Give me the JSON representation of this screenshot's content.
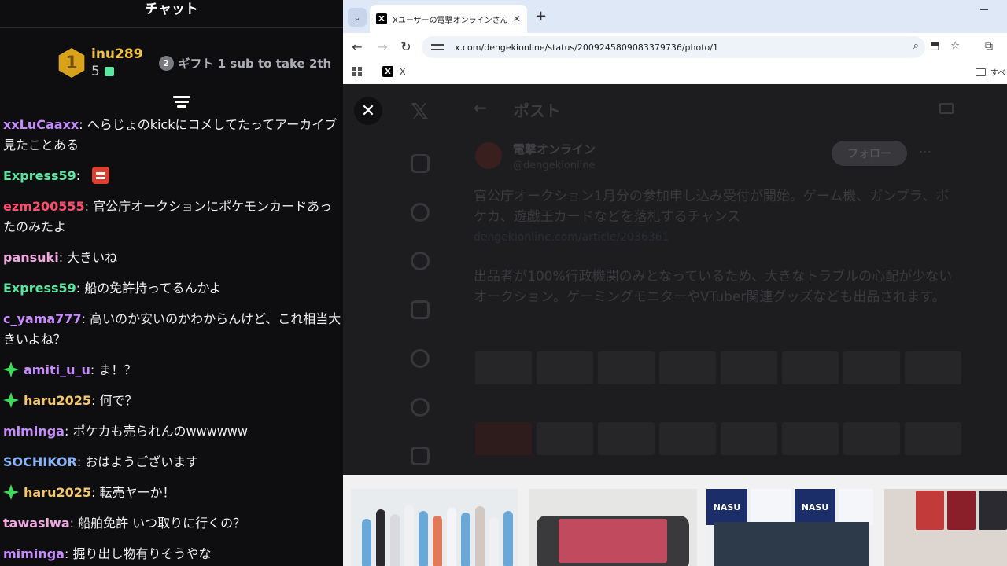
{
  "chat": {
    "title": "チャット",
    "top_gifter": {
      "rank": "1",
      "name": "inu289",
      "count": "5"
    },
    "gift_info": {
      "rank": "2",
      "text": "ギフト 1 sub to take 2th"
    },
    "messages": [
      {
        "user": "xxLuCaaxx",
        "color": "#c68cff",
        "text": "へらじょのkickにコメしてたってアーカイブ見たことある",
        "badge": false,
        "emote": false
      },
      {
        "user": "Express59",
        "color": "#5be7a0",
        "text": "",
        "badge": false,
        "emote": true
      },
      {
        "user": "ezm200555",
        "color": "#ff4d6d",
        "text": "官公庁オークションにポケモンカードあったのみたよ",
        "badge": false,
        "emote": false
      },
      {
        "user": "pansuki",
        "color": "#f2a7e0",
        "text": "大きいね",
        "badge": false,
        "emote": false
      },
      {
        "user": "Express59",
        "color": "#5be7a0",
        "text": "船の免許持ってるんかよ",
        "badge": false,
        "emote": false
      },
      {
        "user": "c_yama777",
        "color": "#c68cff",
        "text": "高いのか安いのかわからんけど、これ相当大きいよね？",
        "badge": false,
        "emote": false
      },
      {
        "user": "amiti_u_u",
        "color": "#c68cff",
        "text": "ま！？",
        "badge": true,
        "emote": false
      },
      {
        "user": "haru2025",
        "color": "#f4c86a",
        "text": "何で？",
        "badge": true,
        "emote": false
      },
      {
        "user": "miminga",
        "color": "#c68cff",
        "text": "ポケカも売られんのwwwwww",
        "badge": false,
        "emote": false
      },
      {
        "user": "SOCHIKOR",
        "color": "#8ab4f8",
        "text": "おはようございます",
        "badge": false,
        "emote": false
      },
      {
        "user": "haru2025",
        "color": "#f4c86a",
        "text": "転売ヤーか！",
        "badge": true,
        "emote": false
      },
      {
        "user": "tawasiwa",
        "color": "#f2a7e0",
        "text": "船舶免許 いつ取りに行くの？",
        "badge": false,
        "emote": false
      },
      {
        "user": "miminga",
        "color": "#c68cff",
        "text": "掘り出し物有りそうやな",
        "badge": false,
        "emote": false
      }
    ]
  },
  "browser": {
    "tab_title": "Xユーザーの電撃オンラインさん:「官",
    "tab_icon": "x-icon",
    "url": "x.com/dengekionline/status/2009245809083379736/photo/1",
    "bookmark_x": "X",
    "bookmark_folder": "すべ"
  },
  "post": {
    "header": "ポスト",
    "author": "電撃オンライン",
    "handle": "@dengekionline",
    "follow_label": "フォロー",
    "body1": "官公庁オークション1月分の参加申し込み受付が開始。ゲーム機、ガンプラ、ポケカ、遊戯王カードなどを落札するチャンス",
    "link": "dengekionline.com/article/2036361",
    "body2": "出品者が100%行政機関のみとなっているため、大きなトラブルの心配が少ないオークション。ゲーミングモニターやVTuber関連グッズなども出品されます。"
  },
  "strip": {
    "nasu_label": "NASU"
  }
}
